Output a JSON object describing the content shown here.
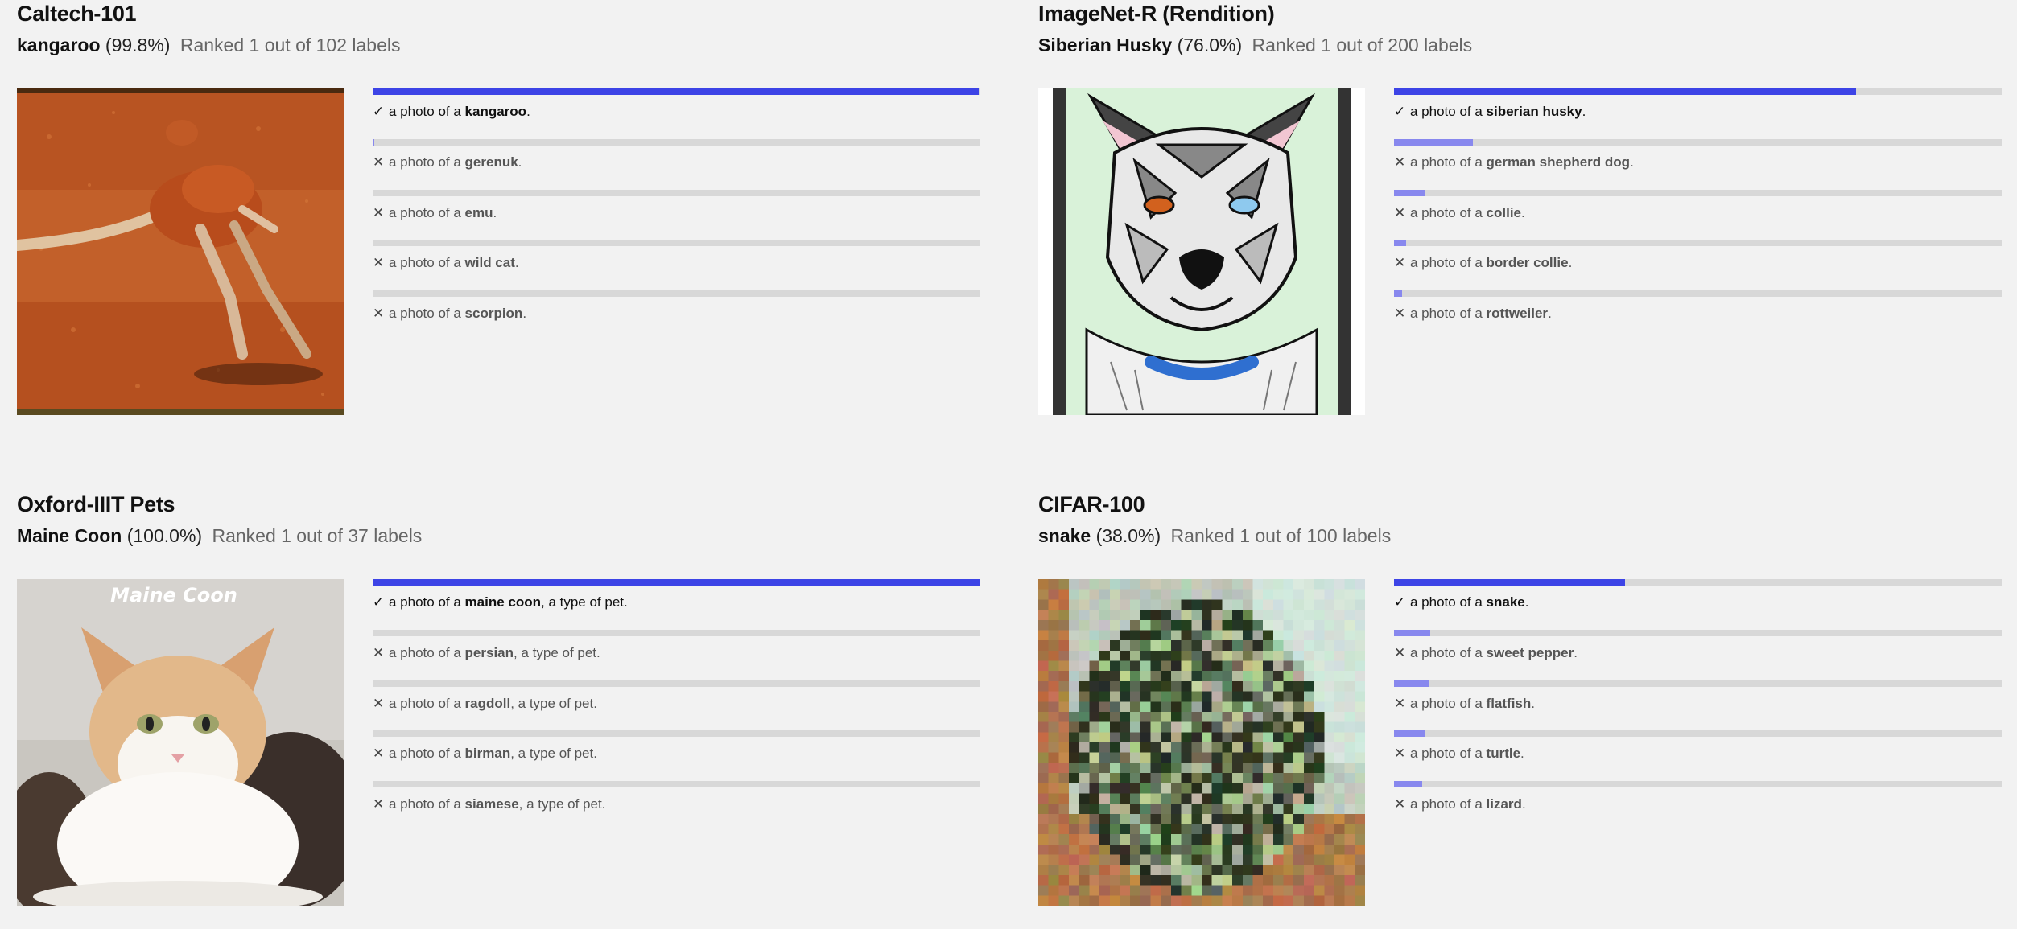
{
  "colors": {
    "background": "#f2f2f2",
    "bar_track": "#d8d8d8",
    "bar_correct": "#3d44e6",
    "bar_other": "#8888ee"
  },
  "icons": {
    "correct": "check-icon",
    "wrong": "x-icon"
  },
  "panels": [
    {
      "dataset": "Caltech-101",
      "prediction": "kangaroo",
      "confidence": "(99.8%)",
      "rank_text": "Ranked 1 out of 102 labels",
      "image_subject": "kangaroo",
      "labels": [
        {
          "mark": "✓",
          "prefix": "a photo of a ",
          "cls": "kangaroo",
          "suffix": ".",
          "score": 0.998,
          "correct": true
        },
        {
          "mark": "✕",
          "prefix": "a photo of a ",
          "cls": "gerenuk",
          "suffix": ".",
          "score": 0.002,
          "correct": false
        },
        {
          "mark": "✕",
          "prefix": "a photo of a ",
          "cls": "emu",
          "suffix": ".",
          "score": 0.001,
          "correct": false
        },
        {
          "mark": "✕",
          "prefix": "a photo of a ",
          "cls": "wild cat",
          "suffix": ".",
          "score": 0.001,
          "correct": false
        },
        {
          "mark": "✕",
          "prefix": "a photo of a ",
          "cls": "scorpion",
          "suffix": ".",
          "score": 0.001,
          "correct": false
        }
      ]
    },
    {
      "dataset": "ImageNet-R (Rendition)",
      "prediction": "Siberian Husky",
      "confidence": "(76.0%)",
      "rank_text": "Ranked 1 out of 200 labels",
      "image_subject": "stained-glass husky drawing",
      "labels": [
        {
          "mark": "✓",
          "prefix": "a photo of a ",
          "cls": "siberian husky",
          "suffix": ".",
          "score": 0.76,
          "correct": true
        },
        {
          "mark": "✕",
          "prefix": "a photo of a ",
          "cls": "german shepherd dog",
          "suffix": ".",
          "score": 0.13,
          "correct": false
        },
        {
          "mark": "✕",
          "prefix": "a photo of a ",
          "cls": "collie",
          "suffix": ".",
          "score": 0.05,
          "correct": false
        },
        {
          "mark": "✕",
          "prefix": "a photo of a ",
          "cls": "border collie",
          "suffix": ".",
          "score": 0.02,
          "correct": false
        },
        {
          "mark": "✕",
          "prefix": "a photo of a ",
          "cls": "rottweiler",
          "suffix": ".",
          "score": 0.013,
          "correct": false
        }
      ]
    },
    {
      "dataset": "Oxford-IIIT Pets",
      "prediction": "Maine Coon",
      "confidence": "(100.0%)",
      "rank_text": "Ranked 1 out of 37 labels",
      "image_subject": "maine coon cat",
      "image_caption": "Maine Coon",
      "labels": [
        {
          "mark": "✓",
          "prefix": "a photo of a ",
          "cls": "maine coon",
          "suffix": ", a type of pet.",
          "score": 1.0,
          "correct": true
        },
        {
          "mark": "✕",
          "prefix": "a photo of a ",
          "cls": "persian",
          "suffix": ", a type of pet.",
          "score": 0.0,
          "correct": false
        },
        {
          "mark": "✕",
          "prefix": "a photo of a ",
          "cls": "ragdoll",
          "suffix": ", a type of pet.",
          "score": 0.0,
          "correct": false
        },
        {
          "mark": "✕",
          "prefix": "a photo of a ",
          "cls": "birman",
          "suffix": ", a type of pet.",
          "score": 0.0,
          "correct": false
        },
        {
          "mark": "✕",
          "prefix": "a photo of a ",
          "cls": "siamese",
          "suffix": ", a type of pet.",
          "score": 0.0,
          "correct": false
        }
      ]
    },
    {
      "dataset": "CIFAR-100",
      "prediction": "snake",
      "confidence": "(38.0%)",
      "rank_text": "Ranked 1 out of 100 labels",
      "image_subject": "pixelated snake",
      "labels": [
        {
          "mark": "✓",
          "prefix": "a photo of a ",
          "cls": "snake",
          "suffix": ".",
          "score": 0.38,
          "correct": true
        },
        {
          "mark": "✕",
          "prefix": "a photo of a ",
          "cls": "sweet pepper",
          "suffix": ".",
          "score": 0.06,
          "correct": false
        },
        {
          "mark": "✕",
          "prefix": "a photo of a ",
          "cls": "flatfish",
          "suffix": ".",
          "score": 0.058,
          "correct": false
        },
        {
          "mark": "✕",
          "prefix": "a photo of a ",
          "cls": "turtle",
          "suffix": ".",
          "score": 0.05,
          "correct": false
        },
        {
          "mark": "✕",
          "prefix": "a photo of a ",
          "cls": "lizard",
          "suffix": ".",
          "score": 0.047,
          "correct": false
        }
      ]
    }
  ]
}
